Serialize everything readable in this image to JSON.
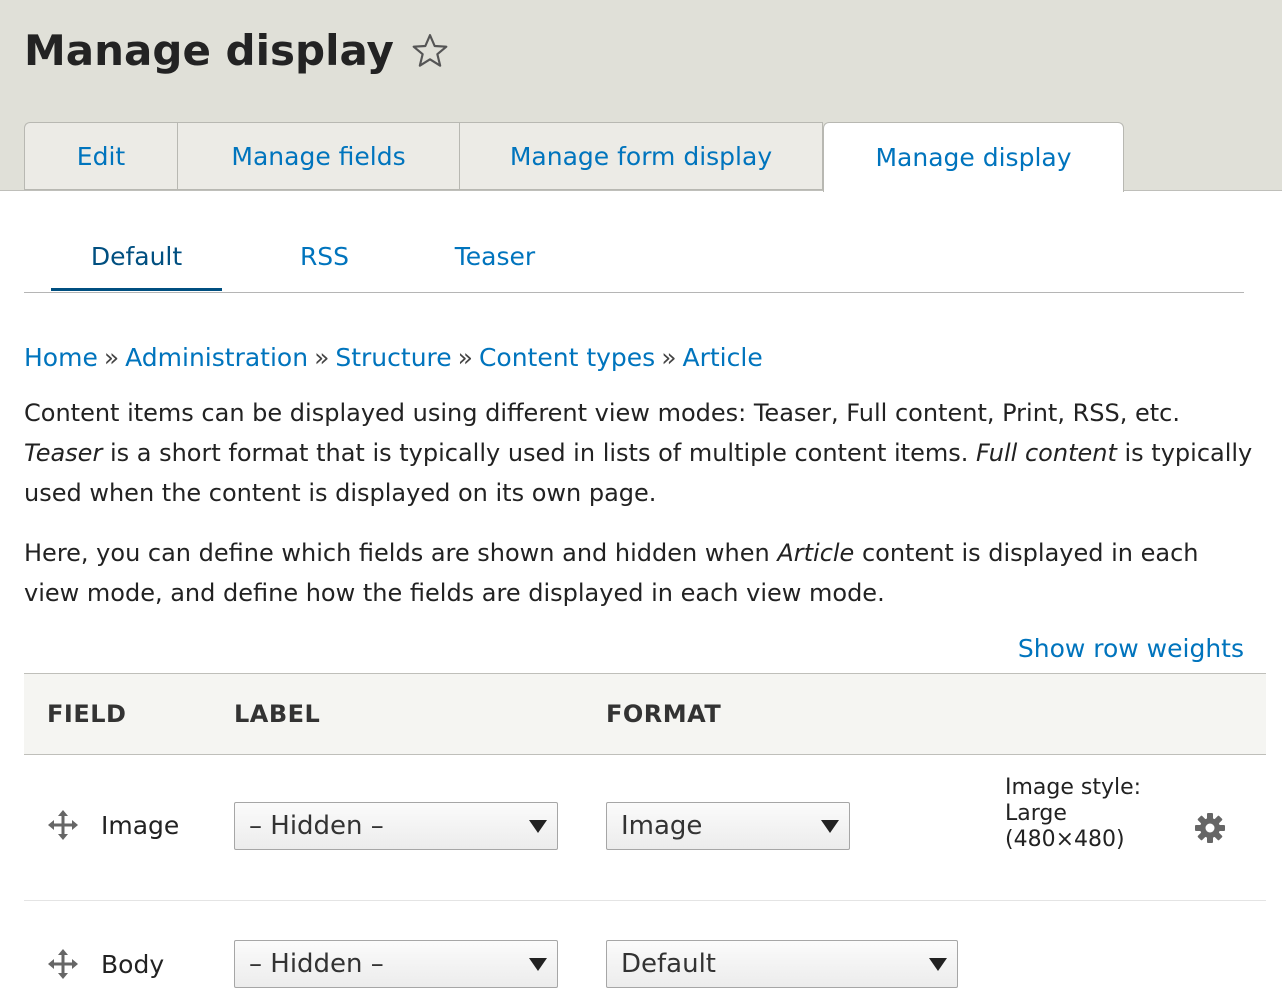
{
  "page": {
    "title": "Manage display"
  },
  "primary_tabs": [
    {
      "label": "Edit"
    },
    {
      "label": "Manage fields"
    },
    {
      "label": "Manage form display"
    },
    {
      "label": "Manage display",
      "active": true
    }
  ],
  "secondary_tabs": [
    {
      "label": "Default",
      "active": true
    },
    {
      "label": "RSS"
    },
    {
      "label": "Teaser"
    }
  ],
  "breadcrumb": {
    "items": [
      "Home",
      "Administration",
      "Structure",
      "Content types",
      "Article"
    ],
    "separator": "»"
  },
  "description": {
    "p1_a": "Content items can be displayed using different view modes: Teaser, Full content, Print, RSS, etc. ",
    "p1_em1": "Teaser",
    "p1_b": " is a short format that is typically used in lists of multiple content items. ",
    "p1_em2": "Full content",
    "p1_c": " is typically used when the content is displayed on its own page.",
    "p2_a": "Here, you can define which fields are shown and hidden when ",
    "p2_em": "Article",
    "p2_b": " content is displayed in each view mode, and define how the fields are displayed in each view mode."
  },
  "show_row_weights": "Show row weights",
  "table": {
    "headers": {
      "field": "FIELD",
      "label": "LABEL",
      "format": "FORMAT"
    },
    "rows": [
      {
        "field": "Image",
        "label_select": "– Hidden –",
        "format_select": "Image",
        "summary": "Image style: Large (480×480)"
      },
      {
        "field": "Body",
        "label_select": "– Hidden –",
        "format_select": "Default"
      }
    ]
  },
  "icons": {
    "star": "star-outline-icon",
    "drag": "move-arrows-icon",
    "settings": "gear-icon"
  },
  "colors": {
    "link": "#0074bd",
    "header_bg": "#e0e0d8",
    "active_secondary_tab": "#004f80"
  }
}
